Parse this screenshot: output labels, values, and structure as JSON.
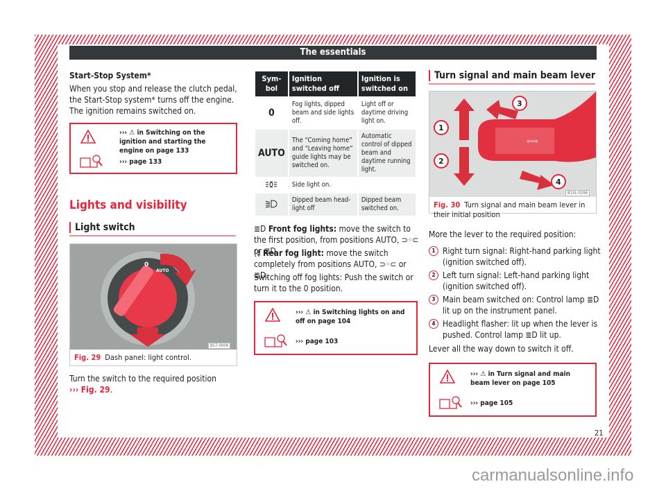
{
  "header": {
    "title": "The essentials"
  },
  "left": {
    "startstop": {
      "title": "Start-Stop System*",
      "body": "When you stop and release the clutch pedal, the Start-Stop system* turns off the engine. The ignition remains switched on.",
      "ref_warning": "››› ⚠ in Switching on the ignition and starting the engine on page 133",
      "ref_page": "››› page 133"
    },
    "section_title": "Lights and visibility",
    "subsection_title": "Light switch",
    "figure": {
      "label": "Fig. 29",
      "caption": "Dash panel: light control.",
      "code": "B57-0006",
      "dial_labels": [
        "0",
        "AUTO"
      ]
    },
    "instruction": "Turn the switch to the required position",
    "instruction_ref_prefix": "›››",
    "instruction_ref": "Fig. 29",
    "instruction_end": "."
  },
  "middle": {
    "table": {
      "headers": [
        "Sym-bol",
        "Ignition switched off",
        "Ignition is switched on"
      ],
      "rows": [
        {
          "symbol": "0",
          "off": "Fog lights, dipped beam and side lights off.",
          "on": "Light off or daytime driving light on."
        },
        {
          "symbol": "AUTO",
          "off": "The “Coming home” and “Leaving home” guide lights may be switched on.",
          "on": "Automatic control of dipped beam and daytime running light."
        },
        {
          "symbol": "side-light-icon",
          "off": "Side light on.",
          "on": ""
        },
        {
          "symbol": "dipped-beam-icon",
          "off": "Dipped beam head-light off",
          "on": "Dipped beam switched on."
        }
      ]
    },
    "front_fog": {
      "label": "Front fog lights:",
      "text": "move the switch to the first position, from positions AUTO, ⊃◦⊂ or ≣D."
    },
    "rear_fog": {
      "label": "Rear fog light:",
      "text": "move the switch completely from positions AUTO, ⊃◦⊂ or ≣D."
    },
    "fog_off": "Switching off fog lights: Push the switch or turn it to the 0 position.",
    "ref_warning": "››› ⚠ in Switching lights on and off on page 104",
    "ref_page": "››› page 103"
  },
  "right": {
    "subsection_title": "Turn signal and main beam lever",
    "figure": {
      "label": "Fig. 30",
      "caption": "Turn signal and main beam lever in their initial position",
      "code": "B1SL-0296",
      "callouts": [
        "1",
        "2",
        "3",
        "4"
      ]
    },
    "intro": "More the lever to the required position:",
    "items": [
      {
        "num": "1",
        "text": "Right turn signal: Right-hand parking light (ignition switched off)."
      },
      {
        "num": "2",
        "text": "Left turn signal: Left-hand parking light (ignition switched off)."
      },
      {
        "num": "3",
        "text": "Main beam switched on: Control lamp ≣D lit up on the instrument panel."
      },
      {
        "num": "4",
        "text": "Headlight flasher: lit up when the lever is pushed. Control lamp ≣D lit up."
      }
    ],
    "outro": "Lever all the way down to switch it off.",
    "ref_warning": "››› ⚠ in Turn signal and main beam lever on page 105",
    "ref_page": "››› page 105"
  },
  "page_number": "21",
  "watermark": "carmanualsonline.info",
  "colors": {
    "accent": "#e8233a",
    "header_bg": "#33383a"
  }
}
